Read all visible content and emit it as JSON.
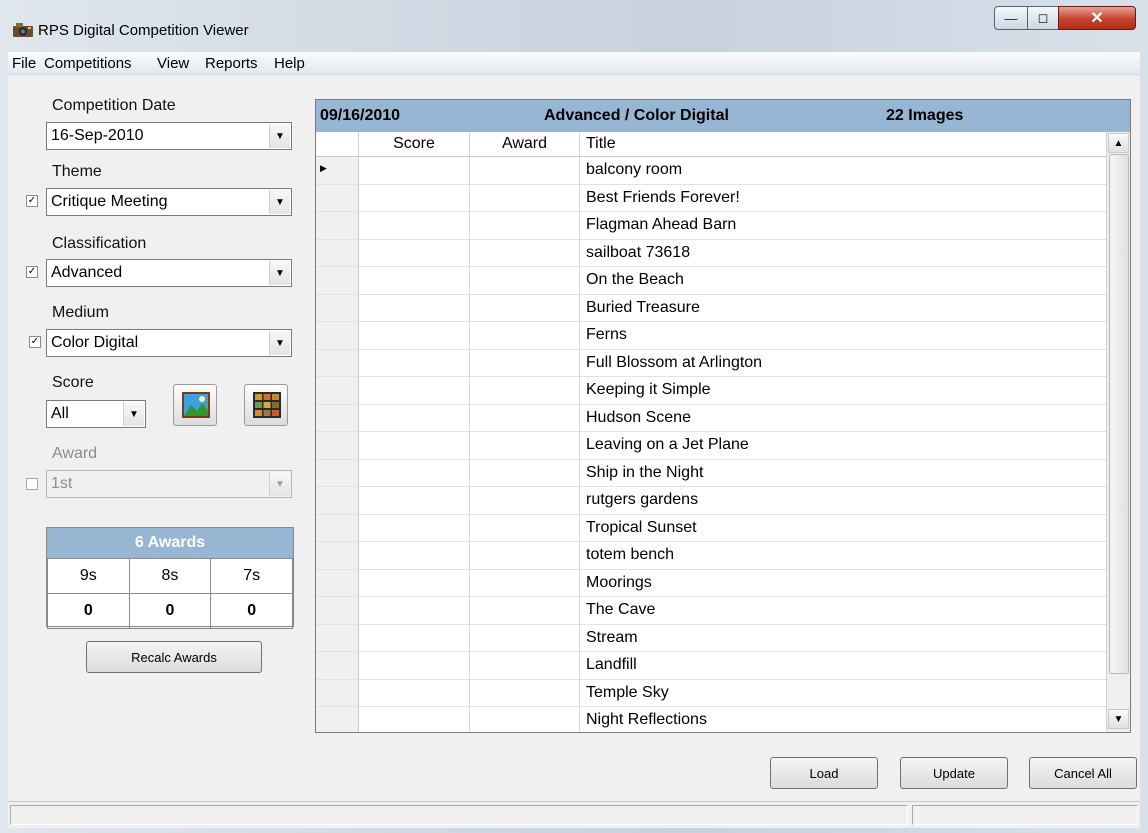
{
  "window": {
    "title": "RPS Digital Competition Viewer"
  },
  "menu": {
    "file": "File",
    "competitions": "Competitions",
    "view": "View",
    "reports": "Reports",
    "help": "Help"
  },
  "filters": {
    "competition_date_label": "Competition Date",
    "competition_date": "16-Sep-2010",
    "theme_label": "Theme",
    "theme": "Critique Meeting",
    "theme_checked": true,
    "classification_label": "Classification",
    "classification": "Advanced",
    "classification_checked": true,
    "medium_label": "Medium",
    "medium": "Color Digital",
    "medium_checked": true,
    "score_label": "Score",
    "score": "All",
    "award_label": "Award",
    "award": "1st",
    "award_checked": false
  },
  "awards": {
    "header": "6 Awards",
    "columns": [
      "9s",
      "8s",
      "7s"
    ],
    "values": [
      "0",
      "0",
      "0"
    ]
  },
  "buttons": {
    "recalc": "Recalc Awards",
    "load": "Load",
    "update": "Update",
    "cancel_all": "Cancel All"
  },
  "grid": {
    "date": "09/16/2010",
    "category": "Advanced / Color Digital",
    "count": "22 Images",
    "columns": {
      "score": "Score",
      "award": "Award",
      "title": "Title"
    },
    "rows": [
      "balcony room",
      "Best Friends Forever!",
      "Flagman Ahead Barn",
      "sailboat 73618",
      "On the Beach",
      "Buried Treasure",
      "Ferns",
      "Full Blossom at Arlington",
      "Keeping it Simple",
      "Hudson Scene",
      "Leaving on a Jet Plane",
      "Ship in the Night",
      "rutgers gardens",
      "Tropical Sunset",
      "totem bench",
      "Moorings",
      "The Cave",
      "Stream",
      "Landfill",
      "Temple Sky",
      "Night Reflections"
    ]
  },
  "icons": {
    "app": "camera-icon",
    "landscape": "landscape-image-icon",
    "thumbnails": "thumbnail-grid-icon"
  },
  "colors": {
    "header_blue": "#97b6d4",
    "close_red": "#c5432e"
  }
}
